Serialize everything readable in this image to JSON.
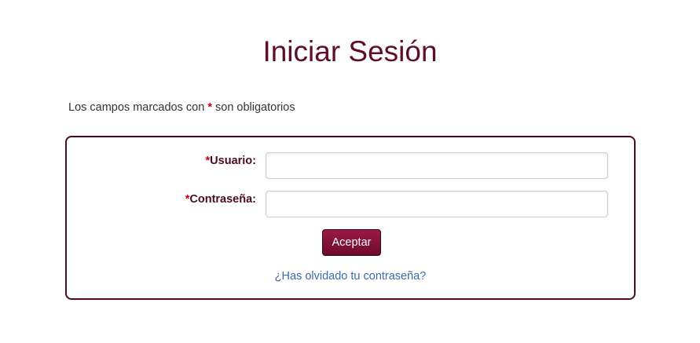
{
  "page": {
    "title": "Iniciar Sesión"
  },
  "notice": {
    "prefix": "Los campos marcados con",
    "asterisk": "*",
    "suffix": "son obligatorios"
  },
  "form": {
    "username": {
      "required_mark": "*",
      "label": "Usuario:",
      "value": ""
    },
    "password": {
      "required_mark": "*",
      "label": "Contraseña:",
      "value": ""
    },
    "submit_label": "Aceptar",
    "forgot_link": "¿Has olvidado tu contraseña?"
  },
  "colors": {
    "title": "#5e0d2a",
    "border": "#4d0a25",
    "required": "#cc0000",
    "button": "#7e1035",
    "link": "#3e6aaa"
  }
}
